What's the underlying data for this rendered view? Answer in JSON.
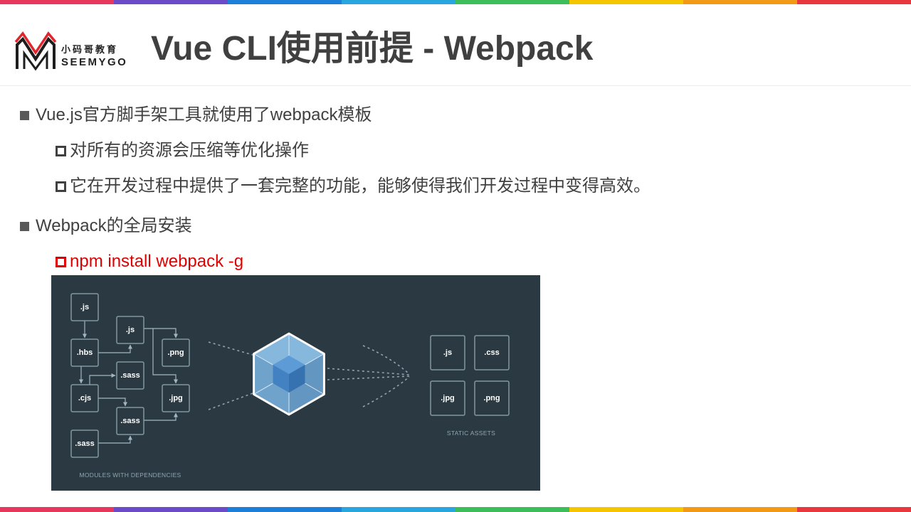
{
  "colors": {
    "text": "#404040",
    "bullet": "#595959",
    "highlight": "#e00000",
    "diagram_background": "#2b3a42",
    "stripe": [
      "#e8375d",
      "#6b4cc6",
      "#1c7fd8",
      "#2aa6df",
      "#3dbe5b",
      "#f5c500",
      "#f29a15",
      "#e8383d"
    ]
  },
  "header": {
    "logo": {
      "icon": "seemygo-m-logo-icon",
      "chinese": "小码哥教育",
      "english": "SEEMYGO"
    },
    "title": "Vue CLI使用前提 - Webpack"
  },
  "bullets": [
    {
      "marker": "filled-square-icon",
      "text": "Vue.js官方脚手架工具就使用了webpack模板",
      "children": [
        {
          "marker": "hollow-square-icon",
          "text": "对所有的资源会压缩等优化操作"
        },
        {
          "marker": "hollow-square-icon",
          "text": "它在开发过程中提供了一套完整的功能，能够使得我们开发过程中变得高效。"
        }
      ]
    },
    {
      "marker": "filled-square-icon",
      "text": "Webpack的全局安装",
      "children": [
        {
          "marker": "hollow-square-icon",
          "text": "npm install webpack -g",
          "color": "#e00000"
        }
      ]
    }
  ],
  "diagram": {
    "modules": [
      ".js",
      ".hbs",
      ".cjs",
      ".sass",
      ".js",
      ".sass",
      ".sass",
      ".png",
      ".jpg"
    ],
    "modules_caption": "MODULES WITH DEPENDENCIES",
    "bundler_icon": "webpack-cube-icon",
    "assets": [
      ".js",
      ".css",
      ".jpg",
      ".png"
    ],
    "assets_caption": "STATIC ASSETS"
  }
}
